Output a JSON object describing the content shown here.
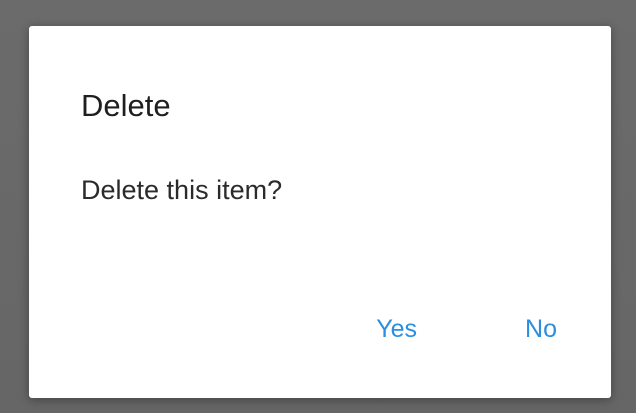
{
  "dialog": {
    "title": "Delete",
    "message": "Delete this item?",
    "actions": {
      "yes_label": "Yes",
      "no_label": "No"
    }
  },
  "colors": {
    "backdrop": "#6a6a6a",
    "dialog_background": "#ffffff",
    "title_text": "#1f1f1f",
    "message_text": "#2b2b2b",
    "action_text": "#2a8fe0"
  }
}
